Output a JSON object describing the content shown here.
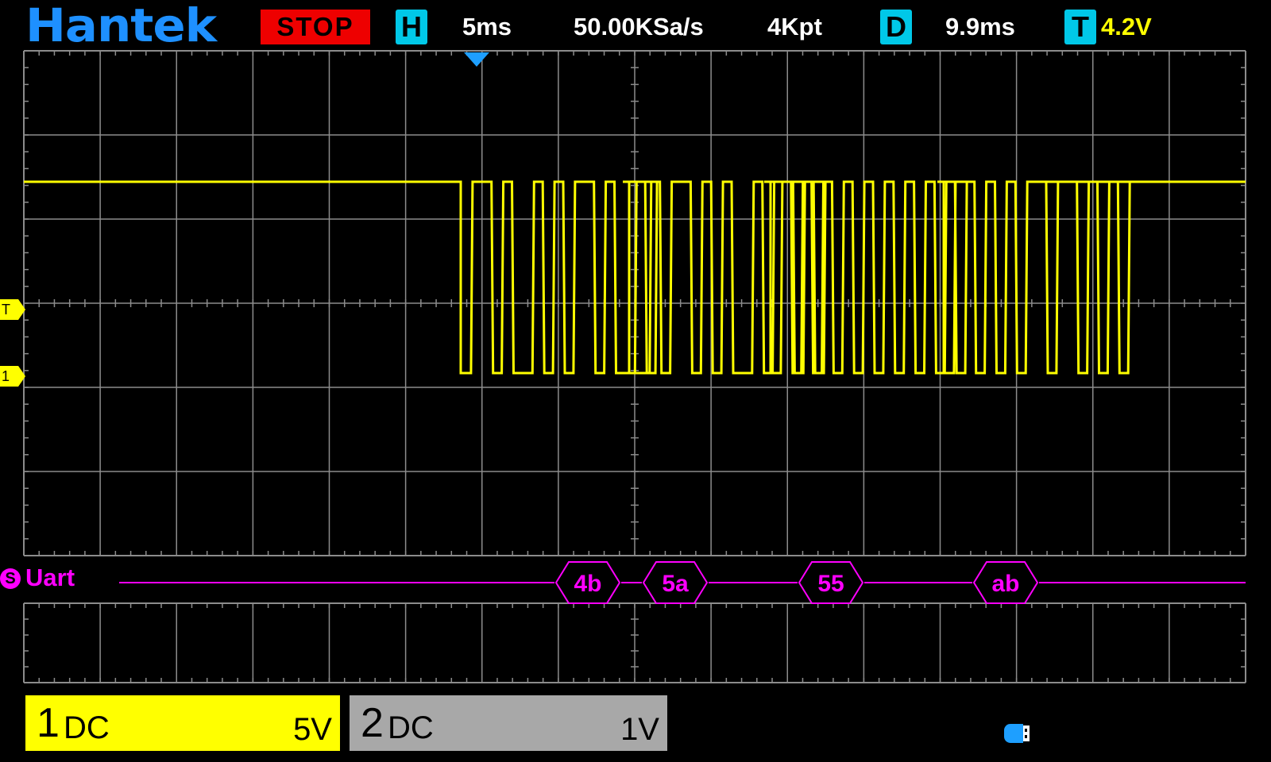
{
  "header": {
    "brand": "Hantek",
    "run_state": "STOP",
    "horizontal_badge": "H",
    "timebase": "5ms",
    "sample_rate": "50.00KSa/s",
    "memory_depth": "4Kpt",
    "delay_badge": "D",
    "delay": "9.9ms",
    "trigger_badge": "T",
    "trigger_level": "4.2V"
  },
  "markers": {
    "trigger_level_marker": "T",
    "channel1_ground_marker": "1"
  },
  "decode": {
    "badge": "S",
    "protocol": "Uart",
    "frames": [
      "4b",
      "5a",
      "55",
      "ab"
    ]
  },
  "channels": [
    {
      "number": "1",
      "coupling": "DC",
      "scale": "5V",
      "color": "#ffff00"
    },
    {
      "number": "2",
      "coupling": "DC",
      "scale": "1V",
      "color": "#a8a8a8"
    }
  ],
  "colors": {
    "grid": "#8c8c8c",
    "channel1_trace": "#ffff00",
    "decode": "#ff00ff",
    "brand": "#1e90ff",
    "stop": "#ee0000",
    "badge": "#00c8e8"
  },
  "icons": {
    "usb": "usb-drive-icon",
    "trigger_position": "trigger-position-icon"
  }
}
